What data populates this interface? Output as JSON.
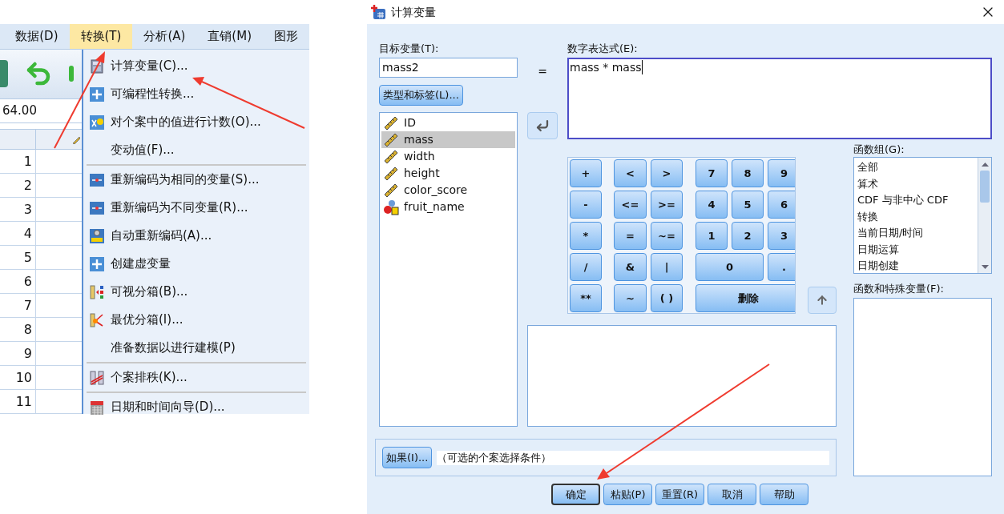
{
  "left": {
    "menu_bar": [
      {
        "label": "数据(D)",
        "selected": false
      },
      {
        "label": "转换(T)",
        "selected": true
      },
      {
        "label": "分析(A)",
        "selected": false
      },
      {
        "label": "直销(M)",
        "selected": false
      },
      {
        "label": "图形",
        "selected": false
      }
    ],
    "cell_value": "64.00",
    "row_numbers": [
      "1",
      "2",
      "3",
      "4",
      "5",
      "6",
      "7",
      "8",
      "9",
      "10",
      "11"
    ],
    "menu": [
      {
        "kind": "calculator",
        "label": "计算变量(C)..."
      },
      {
        "kind": "plus",
        "label": "可编程性转换..."
      },
      {
        "kind": "count",
        "label": "对个案中的值进行计数(O)..."
      },
      {
        "kind": "plain",
        "label": "变动值(F)..."
      },
      {
        "kind": "separator"
      },
      {
        "kind": "recode",
        "label": "重新编码为相同的变量(S)..."
      },
      {
        "kind": "recode",
        "label": "重新编码为不同变量(R)..."
      },
      {
        "kind": "auto",
        "label": "自动重新编码(A)..."
      },
      {
        "kind": "plus",
        "label": "创建虚变量"
      },
      {
        "kind": "bins",
        "label": "可视分箱(B)..."
      },
      {
        "kind": "optimal",
        "label": "最优分箱(I)..."
      },
      {
        "kind": "plain",
        "label": "准备数据以进行建模(P)"
      },
      {
        "kind": "separator"
      },
      {
        "kind": "rank",
        "label": "个案排秩(K)..."
      },
      {
        "kind": "separator"
      },
      {
        "kind": "calendar",
        "label": "日期和时间向导(D)..."
      }
    ]
  },
  "dialog": {
    "title": "计算变量",
    "target_label": "目标变量(T):",
    "target_value": "mass2",
    "type_button": "类型和标签(L)...",
    "variables": [
      {
        "name": "ID",
        "kind": "scale",
        "selected": false
      },
      {
        "name": "mass",
        "kind": "scale",
        "selected": true
      },
      {
        "name": "width",
        "kind": "scale",
        "selected": false
      },
      {
        "name": "height",
        "kind": "scale",
        "selected": false
      },
      {
        "name": "color_score",
        "kind": "scale",
        "selected": false
      },
      {
        "name": "fruit_name",
        "kind": "nominal",
        "selected": false
      }
    ],
    "equals": "=",
    "expression_label": "数字表达式(E):",
    "expression_value": "mass * mass",
    "keypad": [
      [
        {
          "label": "+",
          "kind": "key"
        },
        {
          "label": "<",
          "kind": "key"
        },
        {
          "label": ">",
          "kind": "key"
        },
        {
          "label": "7",
          "kind": "key"
        },
        {
          "label": "8",
          "kind": "key"
        },
        {
          "label": "9",
          "kind": "key"
        }
      ],
      [
        {
          "label": "-",
          "kind": "key"
        },
        {
          "label": "<=",
          "kind": "key"
        },
        {
          "label": ">=",
          "kind": "key"
        },
        {
          "label": "4",
          "kind": "key"
        },
        {
          "label": "5",
          "kind": "key"
        },
        {
          "label": "6",
          "kind": "key"
        }
      ],
      [
        {
          "label": "*",
          "kind": "key"
        },
        {
          "label": "=",
          "kind": "key"
        },
        {
          "label": "~=",
          "kind": "key"
        },
        {
          "label": "1",
          "kind": "key"
        },
        {
          "label": "2",
          "kind": "key"
        },
        {
          "label": "3",
          "kind": "key"
        }
      ],
      [
        {
          "label": "/",
          "kind": "key"
        },
        {
          "label": "&",
          "kind": "key"
        },
        {
          "label": "|",
          "kind": "key"
        },
        {
          "label": "0",
          "kind": "wide"
        },
        {
          "label": ".",
          "kind": "key"
        }
      ],
      [
        {
          "label": "**",
          "kind": "key"
        },
        {
          "label": "~",
          "kind": "key"
        },
        {
          "label": "( )",
          "kind": "key"
        },
        {
          "label": "删除",
          "kind": "wider"
        }
      ]
    ],
    "function_group_label": "函数组(G):",
    "function_groups": [
      "全部",
      "算术",
      "CDF 与非中心 CDF",
      "转换",
      "当前日期/时间",
      "日期运算",
      "日期创建"
    ],
    "functions_label": "函数和特殊变量(F):",
    "if_button": "如果(I)...",
    "if_text": "（可选的个案选择条件）",
    "buttons": [
      {
        "label": "确定",
        "default": true
      },
      {
        "label": "粘贴(P)",
        "default": false
      },
      {
        "label": "重置(R)",
        "default": false
      },
      {
        "label": "取消",
        "default": false
      },
      {
        "label": "帮助",
        "default": false
      }
    ]
  }
}
